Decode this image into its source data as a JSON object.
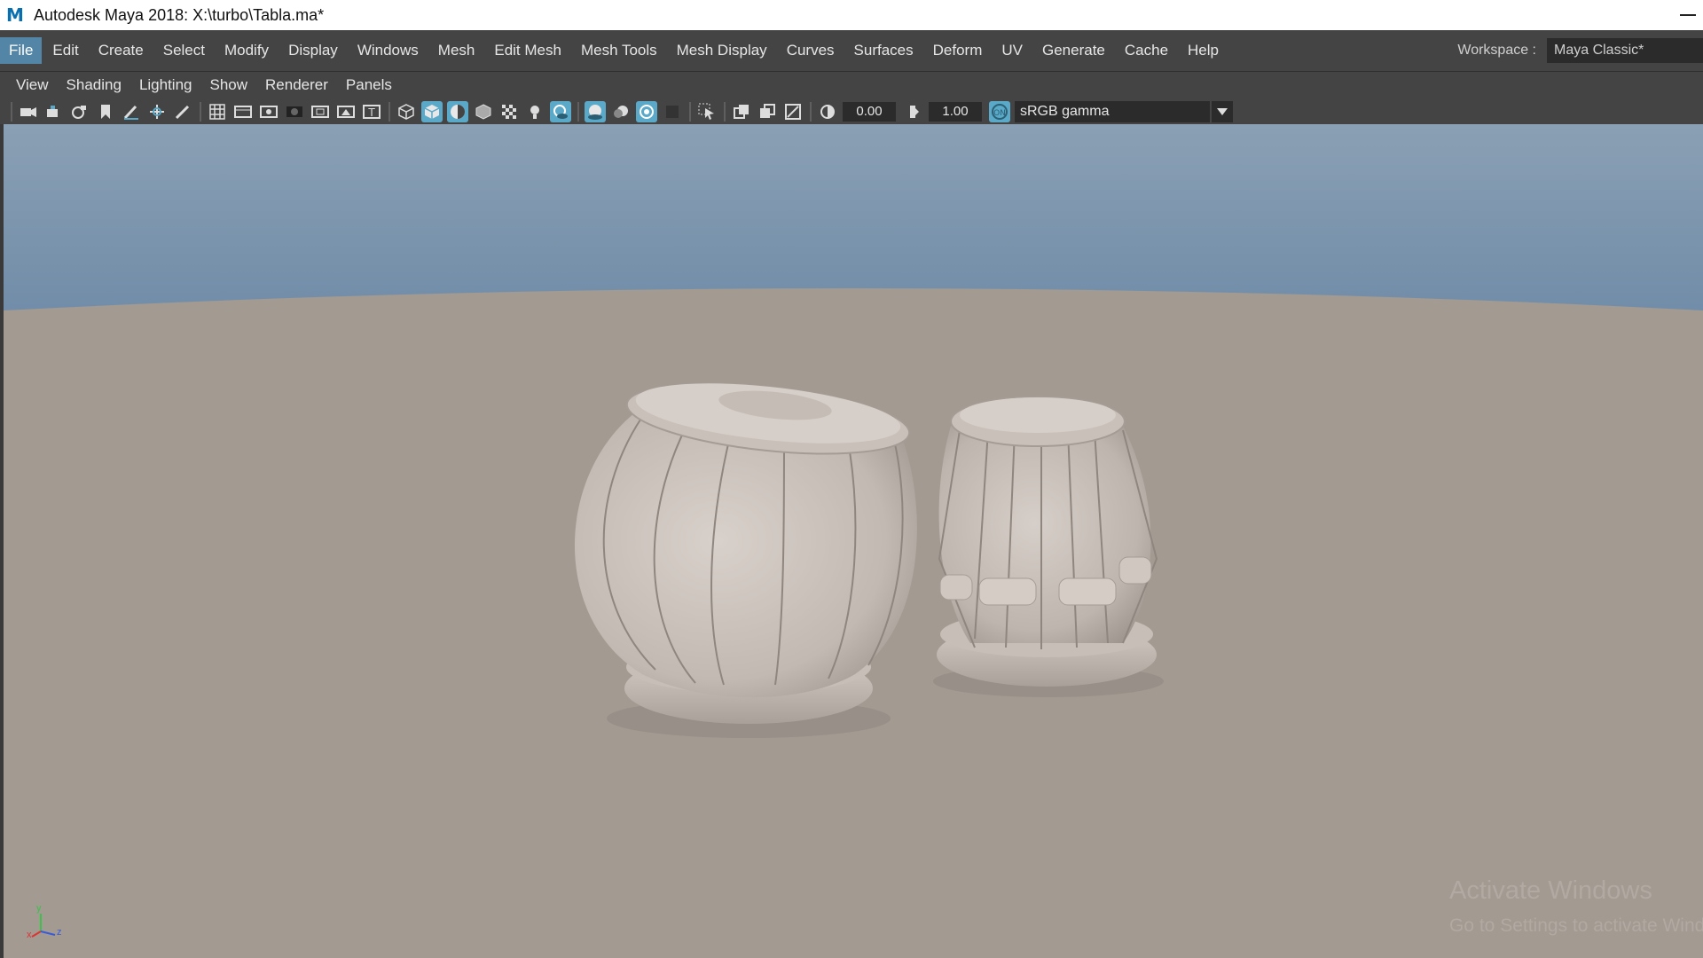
{
  "window": {
    "title": "Autodesk Maya 2018: X:\\turbo\\Tabla.ma*",
    "logo": "M"
  },
  "menubar": {
    "items": [
      "File",
      "Edit",
      "Create",
      "Select",
      "Modify",
      "Display",
      "Windows",
      "Mesh",
      "Edit Mesh",
      "Mesh Tools",
      "Mesh Display",
      "Curves",
      "Surfaces",
      "Deform",
      "UV",
      "Generate",
      "Cache",
      "Help"
    ],
    "active": "File",
    "workspace_label": "Workspace :",
    "workspace_value": "Maya Classic*"
  },
  "panel_menu": {
    "items": [
      "View",
      "Shading",
      "Lighting",
      "Show",
      "Renderer",
      "Panels"
    ]
  },
  "toolbar": {
    "exposure": "0.00",
    "gamma": "1.00",
    "color_space": "sRGB gamma",
    "icons": [
      "camera-icon",
      "camera-attributes-icon",
      "camera-film-icon",
      "bookmark-icon",
      "grease-pencil-icon",
      "move-tool-icon",
      "paint-icon",
      "grid-icon",
      "film-gate-icon",
      "resolution-gate-icon",
      "gate-mask-icon",
      "field-chart-icon",
      "safe-action-icon",
      "safe-title-icon",
      "wireframe-icon",
      "smooth-shade-icon",
      "default-material-icon",
      "wireframe-on-shaded-icon",
      "textured-icon",
      "use-lights-icon",
      "shadows-icon",
      "screen-space-ao-icon",
      "motion-blur-icon",
      "anti-aliasing-icon",
      "depth-of-field-icon",
      "isolate-select-icon",
      "xray-icon",
      "xray-active-icon",
      "xray-joints-icon",
      "exposure-reset-icon",
      "gamma-reset-icon",
      "color-management-icon"
    ]
  },
  "viewport": {
    "sky_color_top": "#7995b0",
    "ground_color": "#a39a92",
    "axis_labels": {
      "x": "x",
      "y": "y",
      "z": "z"
    }
  },
  "watermark": {
    "line1": "Activate Windows",
    "line2": "Go to Settings to activate Windows."
  }
}
